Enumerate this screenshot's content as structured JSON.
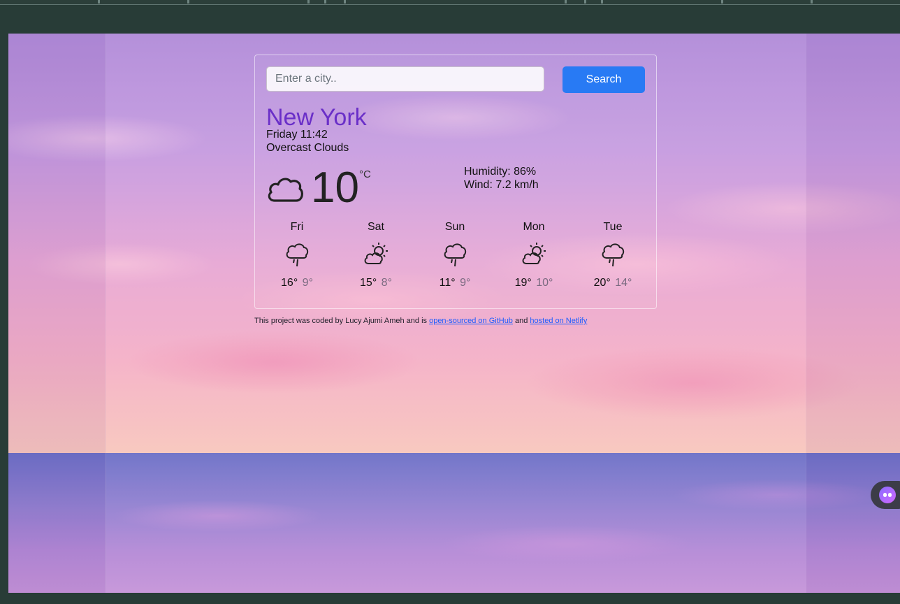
{
  "search": {
    "placeholder": "Enter a city..",
    "value": "",
    "button_label": "Search"
  },
  "current": {
    "city": "New York",
    "date_time": "Friday 11:42",
    "description": "Overcast Clouds",
    "icon": "cloud-icon",
    "temperature": "10",
    "unit": "°C",
    "humidity": "Humidity: 86%",
    "wind": "Wind: 7.2 km/h"
  },
  "forecast": [
    {
      "day": "Fri",
      "icon": "rain-icon",
      "max": "16°",
      "min": "9°"
    },
    {
      "day": "Sat",
      "icon": "partly-sunny-icon",
      "max": "15°",
      "min": "8°"
    },
    {
      "day": "Sun",
      "icon": "rain-icon",
      "max": "11°",
      "min": "9°"
    },
    {
      "day": "Mon",
      "icon": "partly-sunny-icon",
      "max": "19°",
      "min": "10°"
    },
    {
      "day": "Tue",
      "icon": "rain-icon",
      "max": "20°",
      "min": "14°"
    }
  ],
  "footer": {
    "prefix": "This project was coded by Lucy Ajumi Ameh and is",
    "github_link": "open-sourced on GitHub",
    "and": "and",
    "netlify_link": "hosted on Netlify"
  },
  "colors": {
    "accent": "#287af4",
    "city": "#6a2fc8",
    "link": "#1b5cff"
  }
}
